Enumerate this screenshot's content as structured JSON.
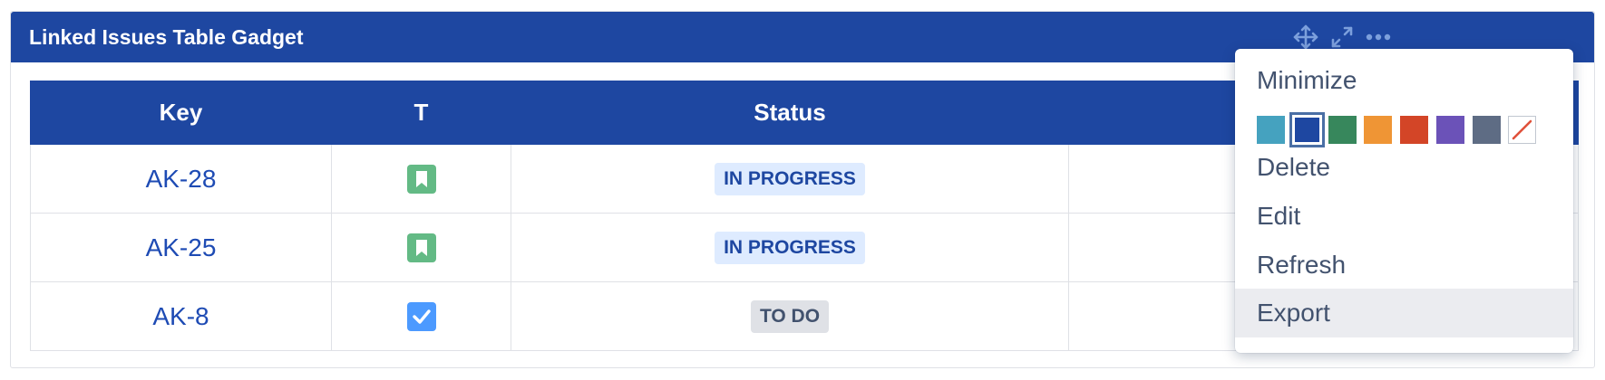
{
  "gadget": {
    "title": "Linked Issues Table Gadget",
    "header_icons": [
      "move-icon",
      "expand-icon",
      "more-icon"
    ]
  },
  "table": {
    "columns": [
      "Key",
      "T",
      "Status",
      ""
    ],
    "rows": [
      {
        "key": "AK-28",
        "type_icon": "story-icon",
        "status": "IN PROGRESS",
        "status_color": "#deebff"
      },
      {
        "key": "AK-25",
        "type_icon": "story-icon",
        "status": "IN PROGRESS",
        "status_color": "#deebff"
      },
      {
        "key": "AK-8",
        "type_icon": "task-icon",
        "status": "TO DO",
        "status_color": "#dfe1e6"
      }
    ]
  },
  "menu": {
    "minimize": "Minimize",
    "colors": [
      "#45a2bf",
      "#1e47a1",
      "#37875c",
      "#ef9535",
      "#d34527",
      "#6b52b8",
      "#5e6c84",
      "none"
    ],
    "selected_color": "#1e47a1",
    "delete": "Delete",
    "edit": "Edit",
    "refresh": "Refresh",
    "export": "Export"
  },
  "colors": {
    "header_bg": "#1e47a1",
    "link": "#1e4bb4",
    "story_icon": "#63ba85",
    "task_icon": "#4c9aff"
  }
}
